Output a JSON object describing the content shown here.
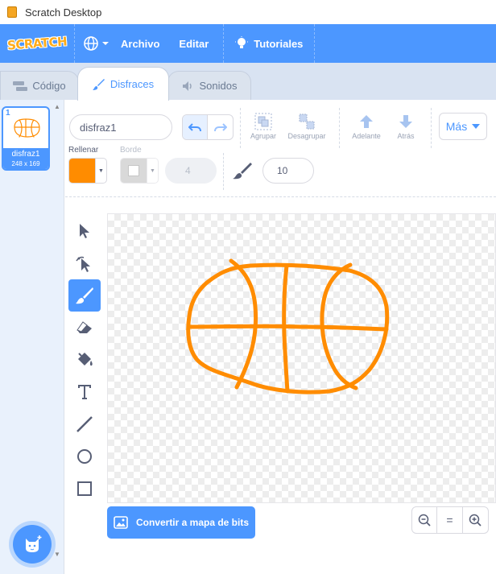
{
  "window": {
    "title": "Scratch Desktop"
  },
  "menubar": {
    "logo": "SCRATCH",
    "items": {
      "file": "Archivo",
      "edit": "Editar",
      "tutorials": "Tutoriales"
    }
  },
  "tabs": {
    "code": "Código",
    "costumes": "Disfraces",
    "sounds": "Sonidos"
  },
  "costume_list": [
    {
      "number": "1",
      "name": "disfraz1",
      "size": "248 x 169"
    }
  ],
  "editor": {
    "costume_name": "disfraz1",
    "toolbar": {
      "group": "Agrupar",
      "ungroup": "Desagrupar",
      "forward": "Adelante",
      "backward": "Atrás",
      "more": "Más"
    },
    "fill_label": "Rellenar",
    "outline_label": "Borde",
    "outline_width": "4",
    "brush_size": "10",
    "fill_color": "#ff8c00",
    "outline_color": "#ffffff",
    "convert_button": "Convertir a mapa de bits",
    "zoom_reset": "="
  },
  "colors": {
    "accent": "#4c97ff",
    "stroke": "#ff8c00"
  },
  "tools": [
    "select-icon",
    "reshape-icon",
    "brush-icon",
    "eraser-icon",
    "fill-icon",
    "text-icon",
    "line-icon",
    "circle-icon",
    "rectangle-icon"
  ]
}
